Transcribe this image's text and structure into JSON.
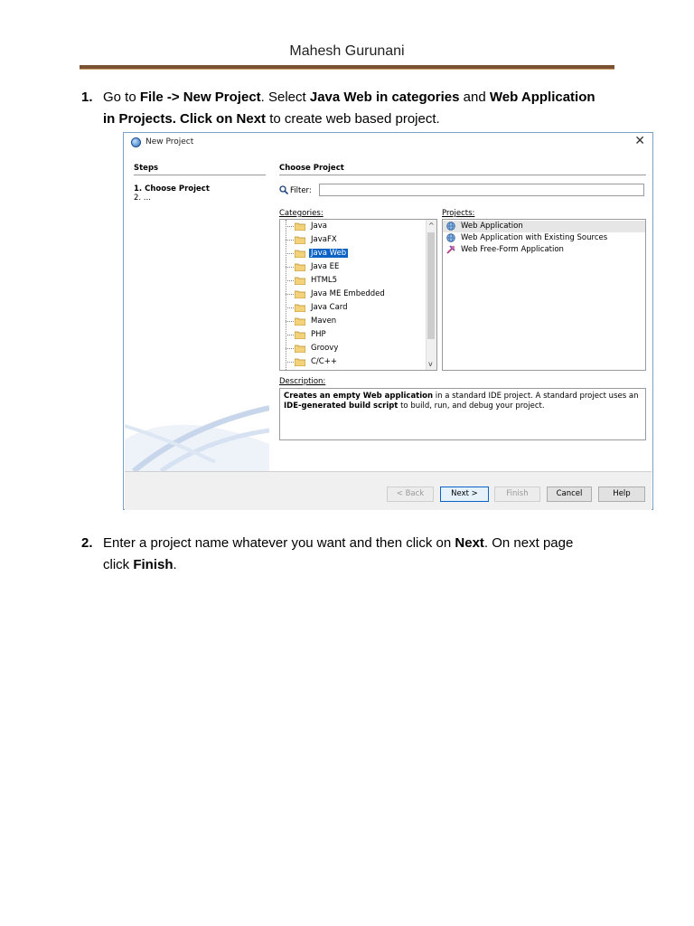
{
  "document": {
    "header": "Mahesh Gurunani",
    "step1": {
      "number": "1.",
      "t1": "Go to ",
      "b1": "File -> New Project",
      "t2": ". Select ",
      "b2": "Java Web in categories",
      "t3": " and ",
      "b3": "Web Application",
      "b4": "in Projects. Click on Next",
      "t4": " to create web based project."
    },
    "step2": {
      "number": "2.",
      "t1": "Enter a project name whatever you want and then click on ",
      "b1": "Next",
      "t2": ". On next page",
      "t3": "click ",
      "b2": "Finish",
      "t4": "."
    }
  },
  "dialog": {
    "title": "New Project",
    "close": "✕",
    "steps": {
      "heading": "Steps",
      "items": [
        "1.    Choose Project",
        "2.    ..."
      ]
    },
    "content": {
      "heading": "Choose Project",
      "filter_label": "Filter:",
      "filter_value": "",
      "categories_label": "Categories:",
      "projects_label": "Projects:",
      "categories": [
        "Java",
        "JavaFX",
        "Java Web",
        "Java EE",
        "HTML5",
        "Java ME Embedded",
        "Java Card",
        "Maven",
        "PHP",
        "Groovy",
        "C/C++"
      ],
      "selected_category": "Java Web",
      "projects": [
        "Web Application",
        "Web Application with Existing Sources",
        "Web Free-Form Application"
      ],
      "selected_project": "Web Application",
      "description_label": "Description:",
      "description": {
        "b1": "Creates an empty Web application",
        "t1": " in a standard IDE project. A standard project uses an ",
        "b2": "IDE-generated build script",
        "t2": " to build, run, and debug your project."
      }
    },
    "buttons": {
      "back": "< Back",
      "next": "Next >",
      "finish": "Finish",
      "cancel": "Cancel",
      "help": "Help"
    },
    "colors": {
      "selection": "#0a63c4",
      "header_rule": "#7a5230"
    }
  }
}
